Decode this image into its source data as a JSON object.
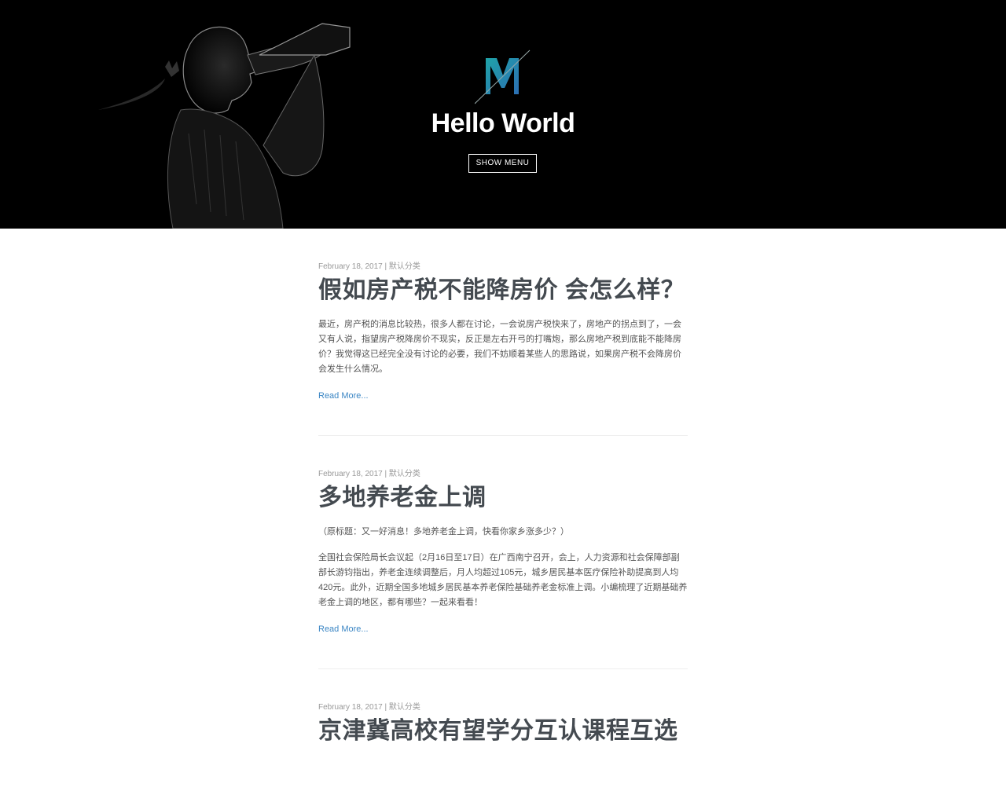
{
  "hero": {
    "title": "Hello World",
    "menu_button": "SHOW MENU",
    "logo_icon": "m-logo-icon",
    "logo_colors": [
      "#1fa3a8",
      "#2c6fb4"
    ]
  },
  "posts": [
    {
      "date": "February 18, 2017",
      "separator": "|",
      "category": "默认分类",
      "title": "假如房产税不能降房价 会怎么样？",
      "paragraphs": [
        "最近，房产税的消息比较热，很多人都在讨论，一会说房产税快来了，房地产的拐点到了，一会又有人说，指望房产税降房价不现实，反正是左右开弓的打嘴炮，那么房地产税到底能不能降房价？我觉得这已经完全没有讨论的必要，我们不妨顺着某些人的思路说，如果房产税不会降房价会发生什么情况。"
      ],
      "read_more": "Read More..."
    },
    {
      "date": "February 18, 2017",
      "separator": "|",
      "category": "默认分类",
      "title": "多地养老金上调",
      "paragraphs": [
        "（原标题：又一好消息！多地养老金上调，快看你家乡涨多少？）",
        "全国社会保险局长会议起（2月16日至17日）在广西南宁召开，会上，人力资源和社会保障部副部长游钧指出，养老金连续调整后，月人均超过105元，城乡居民基本医疗保险补助提高到人均420元。此外，近期全国多地城乡居民基本养老保险基础养老金标准上调。小编梳理了近期基础养老金上调的地区，都有哪些？一起来看看！"
      ],
      "read_more": "Read More..."
    },
    {
      "date": "February 18, 2017",
      "separator": "|",
      "category": "默认分类",
      "title": "京津冀高校有望学分互认课程互选"
    }
  ]
}
